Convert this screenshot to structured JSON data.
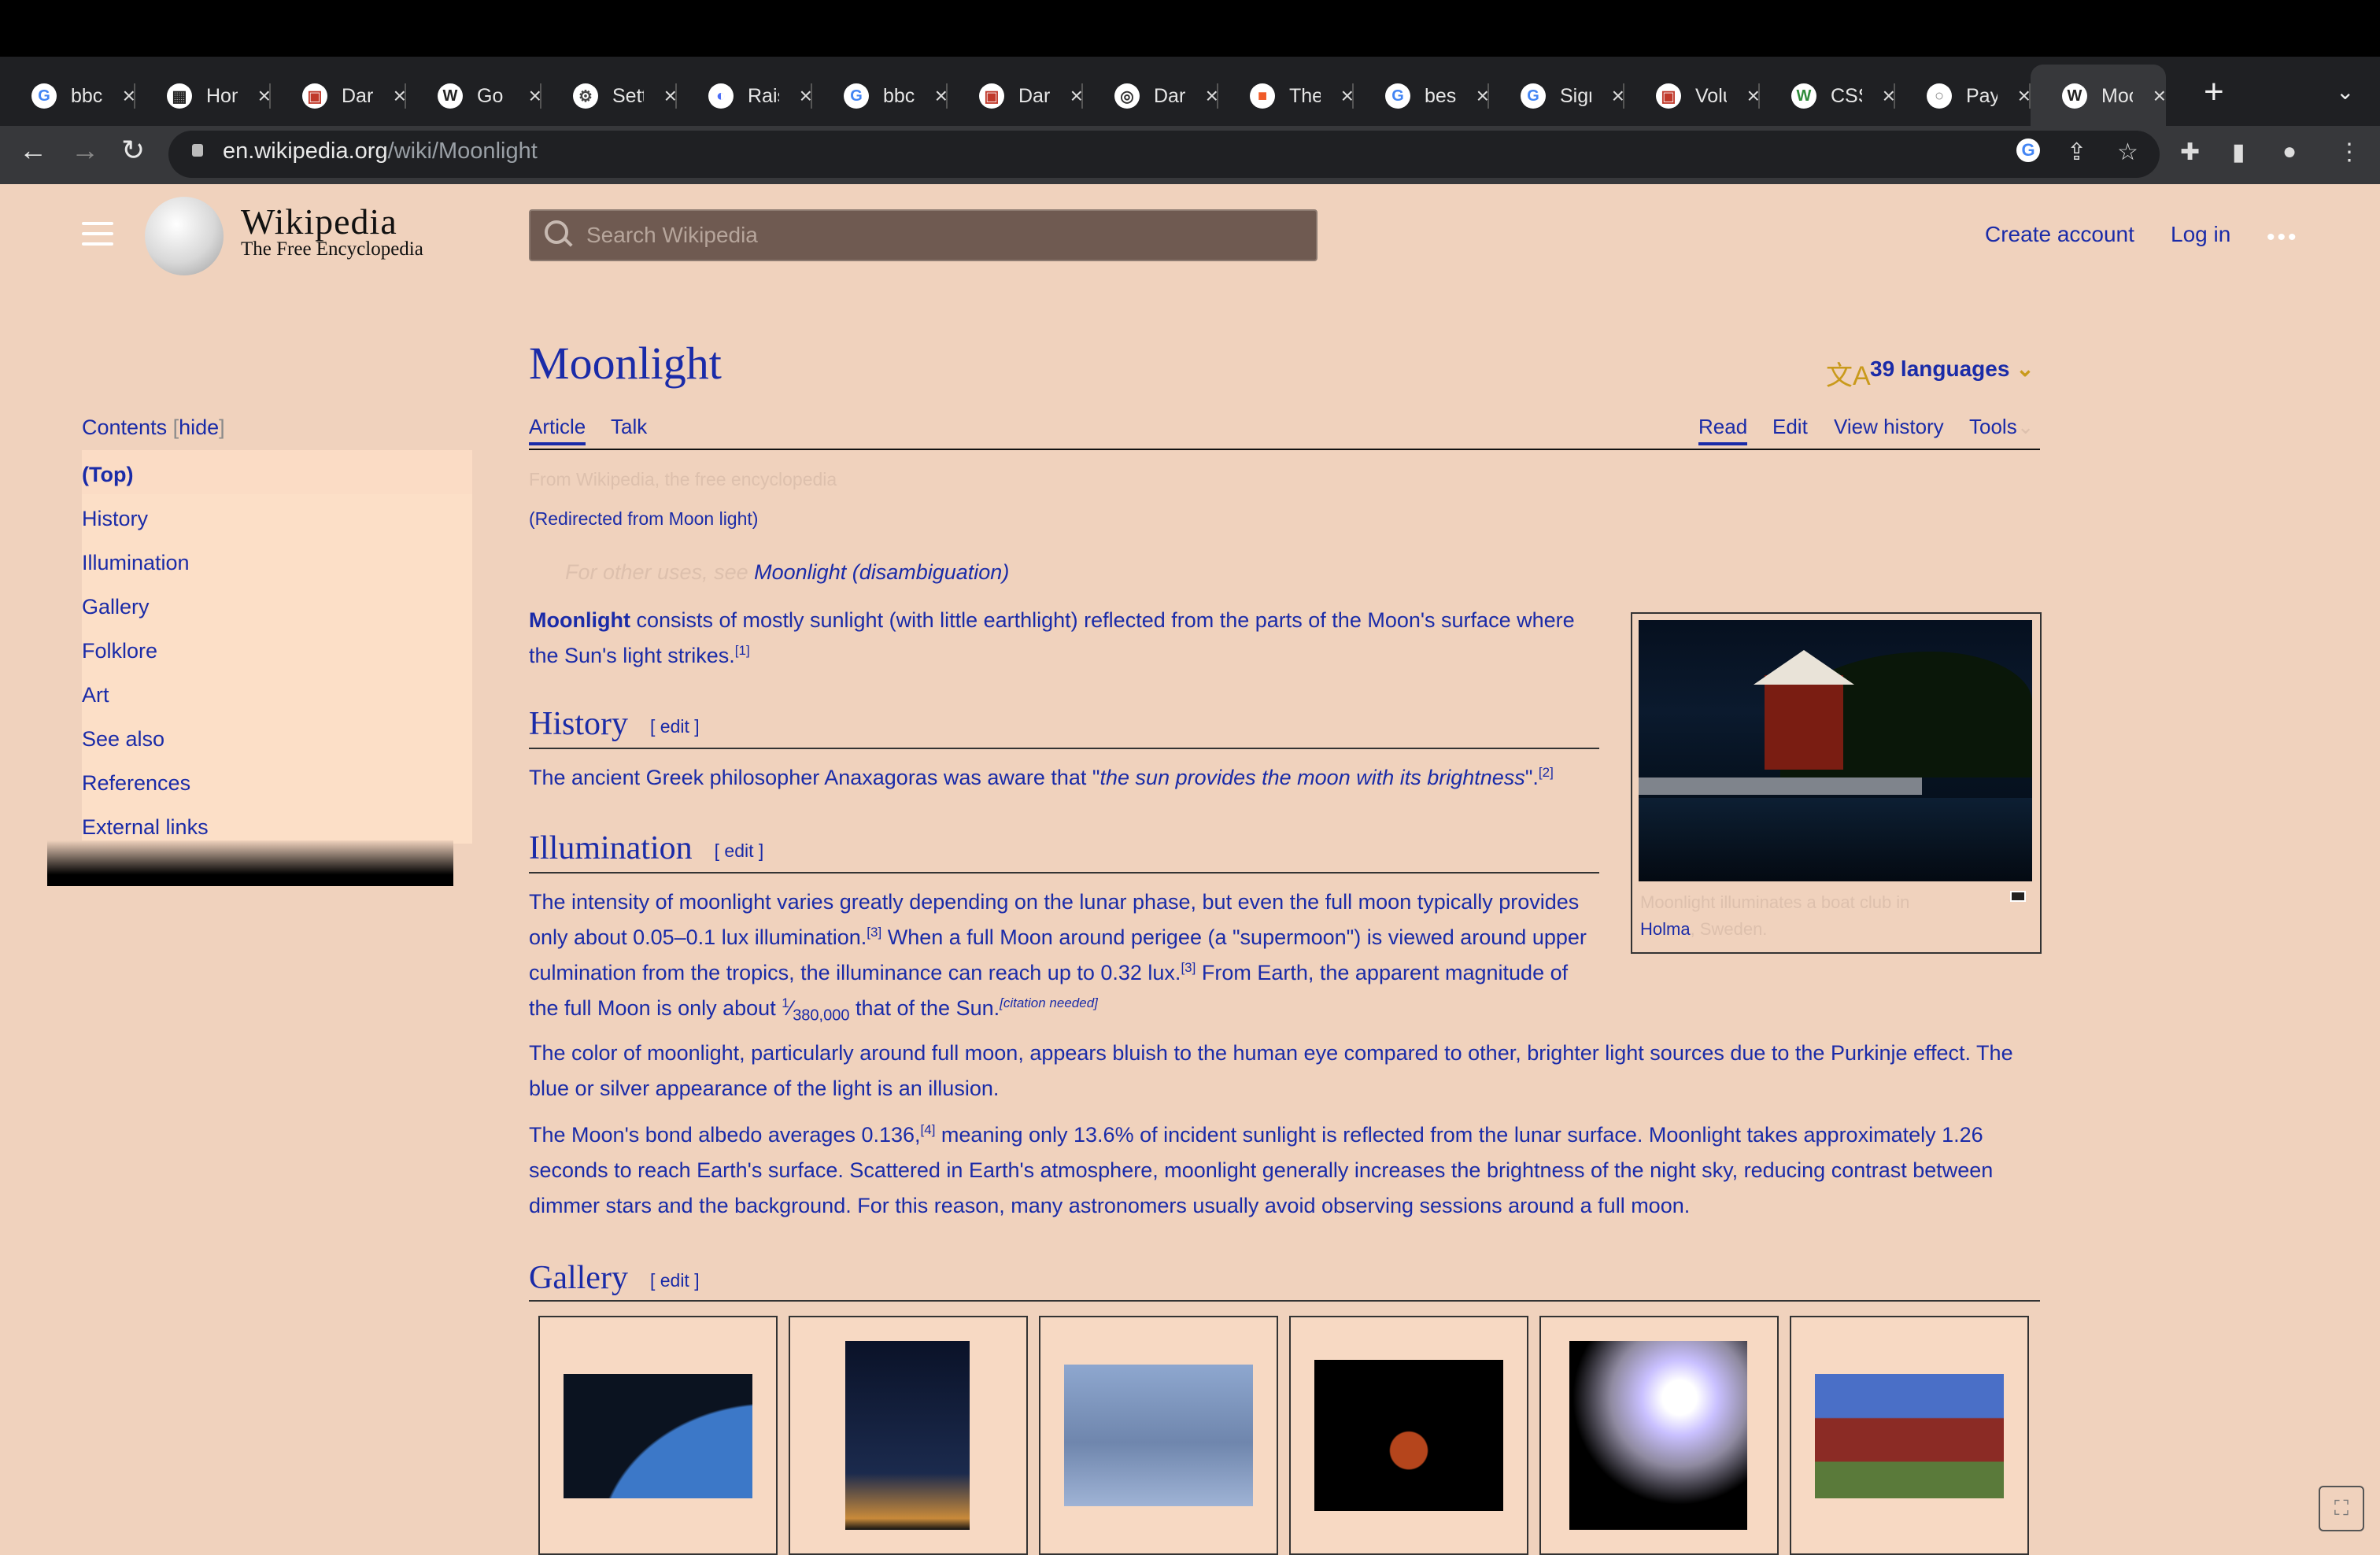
{
  "browser": {
    "tabs": [
      {
        "favicon": "G",
        "title": "bbc",
        "color": "#4285f4"
      },
      {
        "favicon": "▦",
        "title": "Hon",
        "color": "#222222"
      },
      {
        "favicon": "▣",
        "title": "Darl",
        "color": "#c0392b"
      },
      {
        "favicon": "W",
        "title": "Go (",
        "color": "#222222"
      },
      {
        "favicon": "⚙",
        "title": "Sett",
        "color": "#444444"
      },
      {
        "favicon": "◐",
        "title": "Rais",
        "color": "#4a6cf7"
      },
      {
        "favicon": "G",
        "title": "bbc",
        "color": "#4285f4"
      },
      {
        "favicon": "▣",
        "title": "Darl",
        "color": "#c0392b"
      },
      {
        "favicon": "◎",
        "title": "Darl",
        "color": "#333333"
      },
      {
        "favicon": "■",
        "title": "The",
        "color": "#f05a28"
      },
      {
        "favicon": "G",
        "title": "bes",
        "color": "#4285f4"
      },
      {
        "favicon": "G",
        "title": "Sigr",
        "color": "#4285f4"
      },
      {
        "favicon": "▣",
        "title": "Volu",
        "color": "#c0392b"
      },
      {
        "favicon": "W",
        "title": "CSS",
        "color": "#2e8b3a"
      },
      {
        "favicon": "○",
        "title": "Pay",
        "color": "#888888"
      },
      {
        "favicon": "W",
        "title": "Moo",
        "color": "#222222"
      }
    ],
    "url_host": "en.wikipedia.org",
    "url_path": "/wiki/Moonlight"
  },
  "header": {
    "wordmark": "Wikipedia",
    "tagline": "The Free Encyclopedia",
    "search_placeholder": "Search Wikipedia",
    "create_account": "Create account",
    "log_in": "Log in"
  },
  "toc": {
    "title": "Contents",
    "hide": "hide",
    "items": [
      "(Top)",
      "History",
      "Illumination",
      "Gallery",
      "Folklore",
      "Art",
      "See also",
      "References",
      "External links"
    ]
  },
  "article": {
    "title": "Moonlight",
    "languages": "39 languages",
    "tabs_left": [
      "Article",
      "Talk"
    ],
    "tabs_right": [
      "Read",
      "Edit",
      "View history",
      "Tools"
    ],
    "from": "From Wikipedia, the free encyclopedia",
    "redirect": "(Redirected from Moon light)",
    "hatnote_prefix": "For other uses, see",
    "hatnote_link": "Moonlight (disambiguation)",
    "lead_bold": "Moonlight",
    "lead_text": " consists of mostly sunlight (with little earthlight) reflected from the parts of the Moon's surface where the Sun's light strikes.",
    "lead_ref": "[1]",
    "edit_label": "[ edit ]",
    "history_heading": "History",
    "history_text_a": "The ancient Greek philosopher Anaxagoras was aware that \"",
    "history_quote": "the sun provides the moon with its brightness",
    "history_text_b": "\".",
    "history_ref": "[2]",
    "illumination_heading": "Illumination",
    "ill_p1_a": "The intensity of moonlight varies greatly depending on the lunar phase, but even the full moon typically provides only about 0.05–0.1 lux illumination.",
    "ill_p1_ref3": "[3]",
    "ill_p1_b": " When a full Moon around perigee (a \"supermoon\") is viewed around upper culmination from the tropics, the illuminance can reach up to 0.32 lux.",
    "ill_p1_ref3b": "[3]",
    "ill_p1_c": " From Earth, the apparent magnitude of the full Moon is only about ",
    "frac_num": "1",
    "frac_den": "380,000",
    "ill_p1_d": " that of the Sun.",
    "citation_needed": "[citation needed]",
    "ill_p2": "The color of moonlight, particularly around full moon, appears bluish to the human eye compared to other, brighter light sources due to the Purkinje effect. The blue or silver appearance of the light is an illusion.",
    "ill_p3_a": "The Moon's bond albedo averages 0.136,",
    "ill_p3_ref": "[4]",
    "ill_p3_b": " meaning only 13.6% of incident sunlight is reflected from the lunar surface. Moonlight takes approximately 1.26 seconds to reach Earth's surface. Scattered in Earth's atmosphere, moonlight generally increases the brightness of the night sky, reducing contrast between dimmer stars and the background. For this reason, many astronomers usually avoid observing sessions around a full moon.",
    "gallery_heading": "Gallery",
    "caption_faint": "Moonlight illuminates a boat club in",
    "caption_link": "Holma",
    "caption_tail": ", Sweden."
  }
}
